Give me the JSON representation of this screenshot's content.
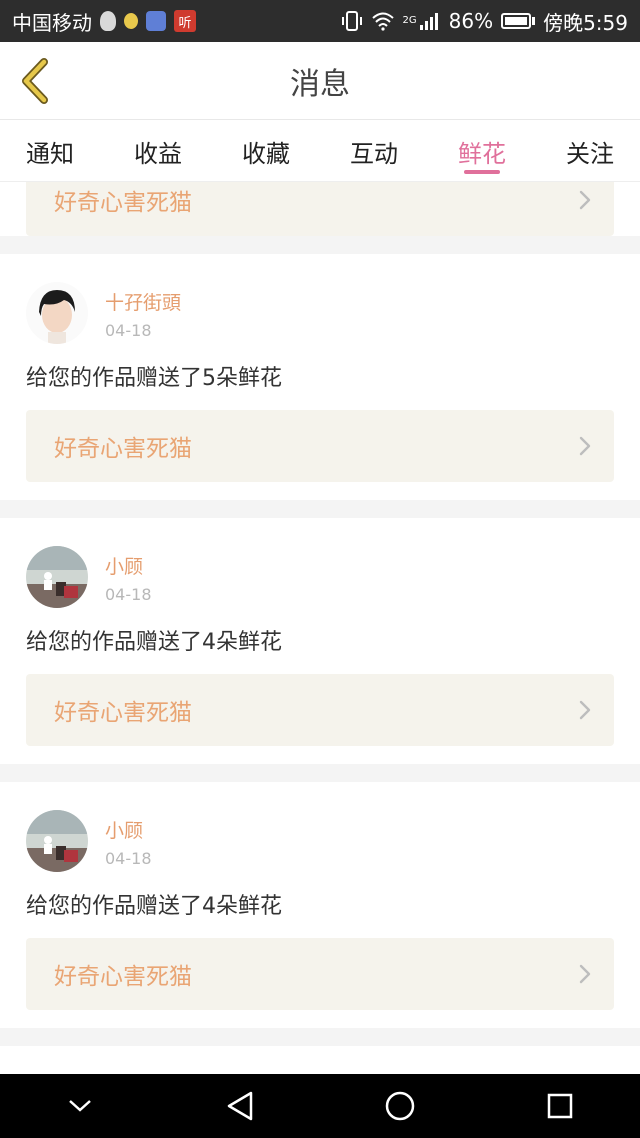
{
  "status_bar": {
    "carrier": "中国移动",
    "app_icon_ting": "听",
    "network_label": "2G",
    "battery": "86%",
    "time": "傍晚5:59",
    "icons": [
      "qq-icon",
      "bulb-icon",
      "music-icon",
      "ting-icon",
      "vibrate-icon",
      "wifi-icon",
      "signal-icon",
      "battery-icon"
    ]
  },
  "header": {
    "title": "消息"
  },
  "tabs": [
    {
      "label": "通知",
      "active": false
    },
    {
      "label": "收益",
      "active": false
    },
    {
      "label": "收藏",
      "active": false
    },
    {
      "label": "互动",
      "active": false
    },
    {
      "label": "鲜花",
      "active": true
    },
    {
      "label": "关注",
      "active": false
    }
  ],
  "feed": {
    "partial_card": {
      "work_title": "好奇心害死猫"
    },
    "cards": [
      {
        "username": "十孖街頭",
        "date": "04-18",
        "message": "给您的作品赠送了5朵鲜花",
        "work_title": "好奇心害死猫",
        "avatar": "avatar-short-hair"
      },
      {
        "username": "小顾",
        "date": "04-18",
        "message": "给您的作品赠送了4朵鲜花",
        "work_title": "好奇心害死猫",
        "avatar": "avatar-landscape"
      },
      {
        "username": "小顾",
        "date": "04-18",
        "message": "给您的作品赠送了4朵鲜花",
        "work_title": "好奇心害死猫",
        "avatar": "avatar-landscape"
      }
    ]
  },
  "colors": {
    "accent_pink": "#e0709b",
    "username_orange": "#e59d6e",
    "work_title_orange": "#e9a574",
    "work_bg": "#f5f3ec",
    "back_arrow": "#e6c84a"
  }
}
